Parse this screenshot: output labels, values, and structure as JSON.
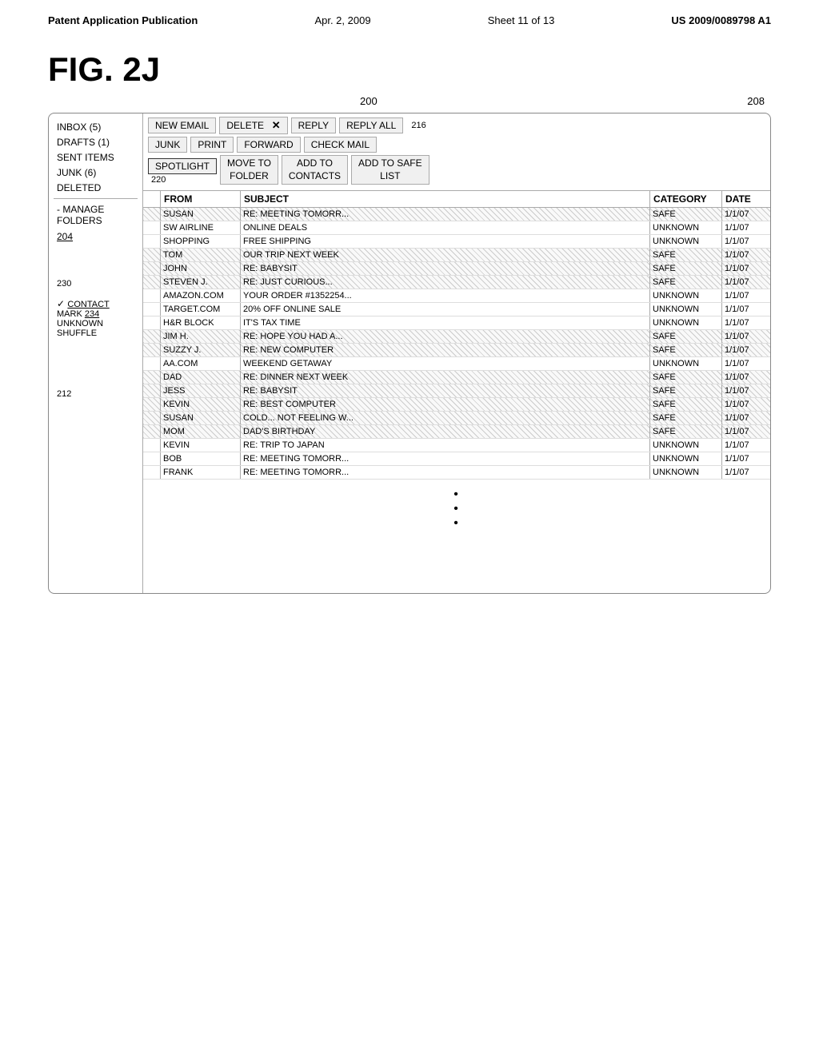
{
  "header": {
    "pub_label": "Patent Application Publication",
    "date": "Apr. 2, 2009",
    "sheet": "Sheet 11 of 13",
    "patent": "US 2009/0089798 A1"
  },
  "figure": {
    "label": "FIG. 2J",
    "ref_200": "200",
    "ref_208": "208",
    "ref_216": "216",
    "ref_220": "220",
    "ref_230": "230",
    "ref_204": "204",
    "ref_212": "212",
    "ref_234": "234"
  },
  "sidebar": {
    "items": [
      {
        "label": "INBOX (5)",
        "selected": false
      },
      {
        "label": "DRAFTS (1)",
        "selected": false
      },
      {
        "label": "SENT ITEMS",
        "selected": false
      },
      {
        "label": "JUNK (6)",
        "selected": false
      },
      {
        "label": "DELETED",
        "selected": false
      }
    ],
    "manage_label": "- MANAGE\nFOLDERS",
    "contact_check": "✓ CONTACT",
    "mark_label": "MARK",
    "unknown_label": "UNKNOWN",
    "shuffle_label": "SHUFFLE"
  },
  "toolbar": {
    "row1": [
      {
        "label": "NEW EMAIL"
      },
      {
        "label": "DELETE",
        "has_x": true
      },
      {
        "label": "REPLY"
      },
      {
        "label": "REPLY ALL"
      }
    ],
    "row2": [
      {
        "label": "JUNK"
      },
      {
        "label": "PRINT"
      },
      {
        "label": "FORWARD"
      },
      {
        "label": "CHECK MAIL"
      }
    ],
    "row3": [
      {
        "label": "SPOTLIGHT",
        "spotlight": true
      },
      {
        "label": "MOVE TO\nFOLDER"
      },
      {
        "label": "ADD TO\nCONTACTS"
      },
      {
        "label": "ADD TO SAFE\nLIST"
      }
    ]
  },
  "email_table": {
    "headers": [
      "FROM",
      "SUBJECT",
      "CATEGORY",
      "DATE"
    ],
    "rows": [
      {
        "from": "SUSAN",
        "subject": "RE: MEETING TOMORR...",
        "category": "SAFE",
        "date": "1/1/07",
        "safe": true
      },
      {
        "from": "SW AIRLINE",
        "subject": "ONLINE DEALS",
        "category": "UNKNOWN",
        "date": "1/1/07",
        "safe": false
      },
      {
        "from": "SHOPPING",
        "subject": "FREE SHIPPING",
        "category": "UNKNOWN",
        "date": "1/1/07",
        "safe": false
      },
      {
        "from": "TOM",
        "subject": "OUR TRIP NEXT WEEK",
        "category": "SAFE",
        "date": "1/1/07",
        "safe": true
      },
      {
        "from": "JOHN",
        "subject": "RE: BABYSIT",
        "category": "SAFE",
        "date": "1/1/07",
        "safe": true
      },
      {
        "from": "STEVEN J.",
        "subject": "RE: JUST CURIOUS...",
        "category": "SAFE",
        "date": "1/1/07",
        "safe": true
      },
      {
        "from": "AMAZON.COM",
        "subject": "YOUR ORDER #1352254...",
        "category": "UNKNOWN",
        "date": "1/1/07",
        "safe": false
      },
      {
        "from": "TARGET.COM",
        "subject": "20% OFF ONLINE SALE",
        "category": "UNKNOWN",
        "date": "1/1/07",
        "safe": false
      },
      {
        "from": "H&R BLOCK",
        "subject": "IT'S TAX TIME",
        "category": "UNKNOWN",
        "date": "1/1/07",
        "safe": false
      },
      {
        "from": "JIM H.",
        "subject": "RE: HOPE YOU HAD A...",
        "category": "SAFE",
        "date": "1/1/07",
        "safe": true
      },
      {
        "from": "SUZZY J.",
        "subject": "RE: NEW COMPUTER",
        "category": "SAFE",
        "date": "1/1/07",
        "safe": true
      },
      {
        "from": "AA.COM",
        "subject": "WEEKEND GETAWAY",
        "category": "UNKNOWN",
        "date": "1/1/07",
        "safe": false
      },
      {
        "from": "DAD",
        "subject": "RE: DINNER NEXT WEEK",
        "category": "SAFE",
        "date": "1/1/07",
        "safe": true
      },
      {
        "from": "JESS",
        "subject": "RE: BABYSIT",
        "category": "SAFE",
        "date": "1/1/07",
        "safe": true
      },
      {
        "from": "KEVIN",
        "subject": "RE: BEST COMPUTER",
        "category": "SAFE",
        "date": "1/1/07",
        "safe": true
      },
      {
        "from": "SUSAN",
        "subject": "COLD... NOT FEELING W...",
        "category": "SAFE",
        "date": "1/1/07",
        "safe": true
      },
      {
        "from": "MOM",
        "subject": "DAD'S BIRTHDAY",
        "category": "SAFE",
        "date": "1/1/07",
        "safe": true
      },
      {
        "from": "KEVIN",
        "subject": "RE: TRIP TO JAPAN",
        "category": "UNKNOWN",
        "date": "1/1/07",
        "safe": false
      },
      {
        "from": "BOB",
        "subject": "RE: MEETING TOMORR...",
        "category": "UNKNOWN",
        "date": "1/1/07",
        "safe": false
      },
      {
        "from": "FRANK",
        "subject": "RE: MEETING TOMORR...",
        "category": "UNKNOWN",
        "date": "1/1/07",
        "safe": false
      }
    ]
  }
}
